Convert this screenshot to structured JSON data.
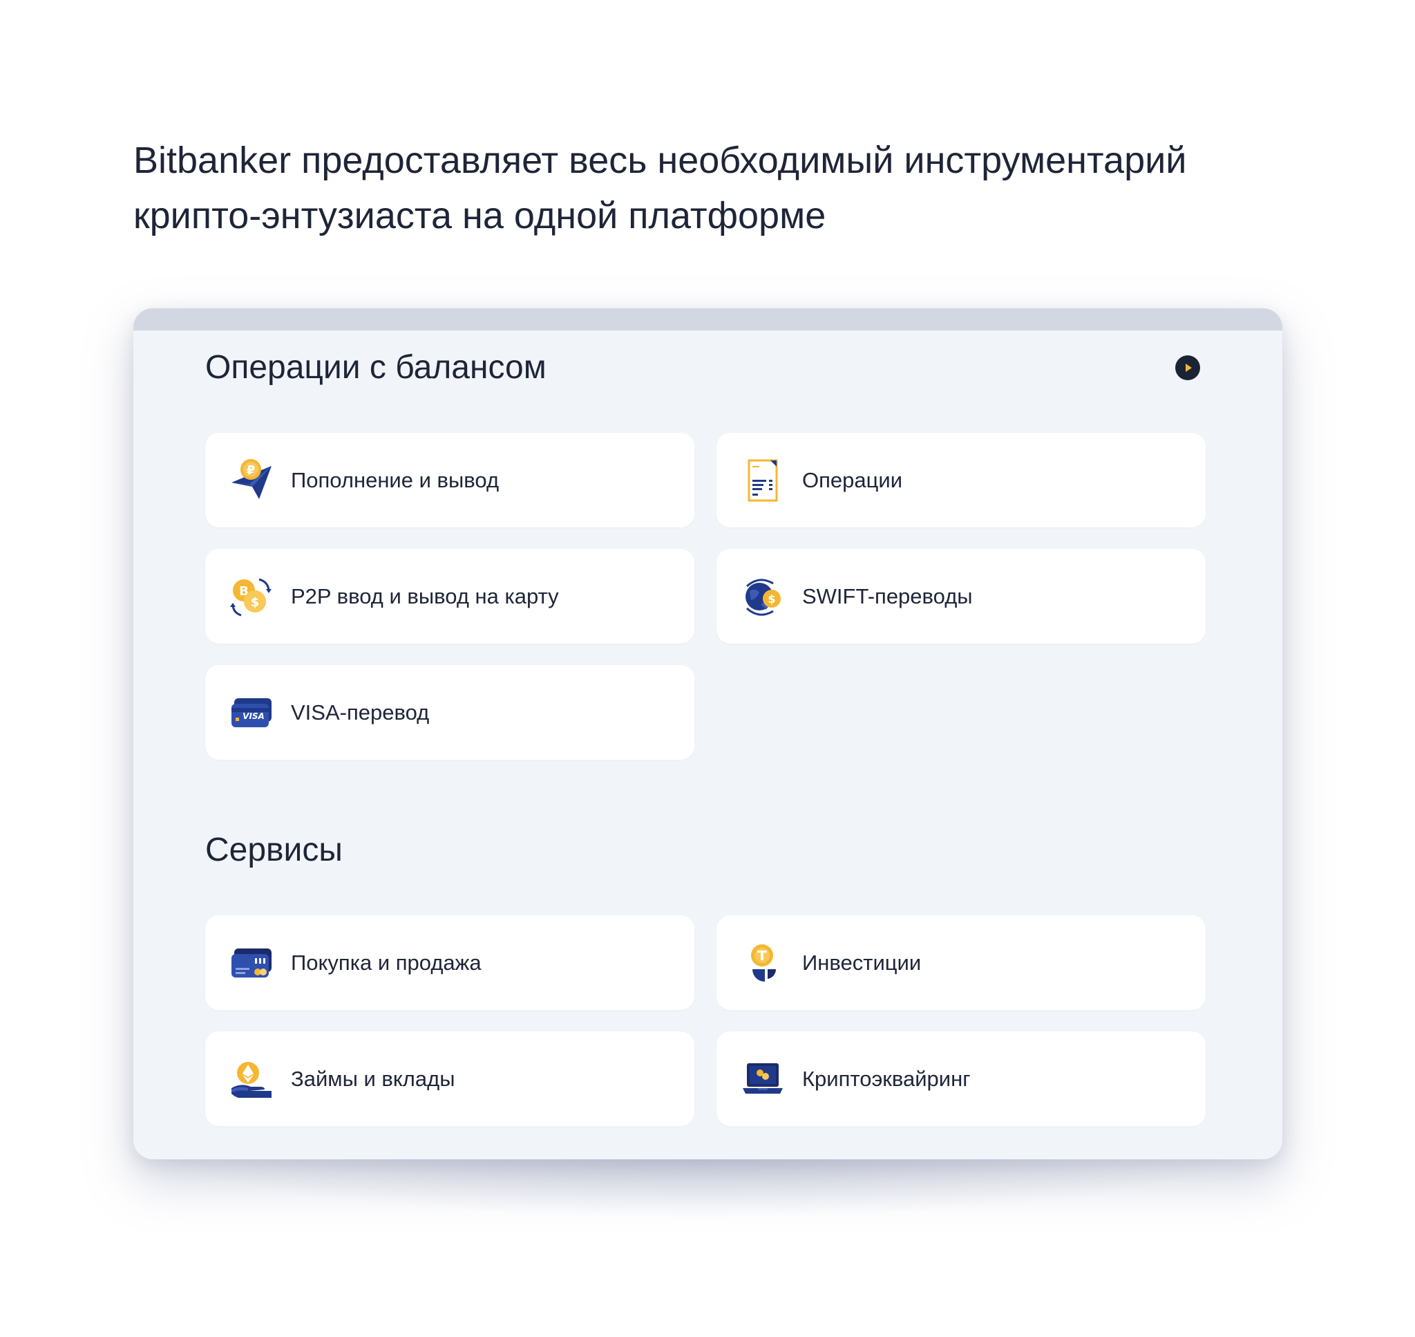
{
  "headline": {
    "line1": "Bitbanker предоставляет весь необходимый инструментарий",
    "line2": "крипто-энтузиаста на одной платформе"
  },
  "balance_ops": {
    "title": "Операции с балансом",
    "play_icon": "play-icon",
    "items": [
      {
        "label": "Пополнение и вывод",
        "icon": "paper-plane-ruble-icon"
      },
      {
        "label": "Операции",
        "icon": "document-list-icon"
      },
      {
        "label": "P2P ввод и вывод на карту",
        "icon": "coin-exchange-icon"
      },
      {
        "label": "SWIFT-переводы",
        "icon": "globe-dollar-icon"
      },
      {
        "label": "VISA-перевод",
        "icon": "visa-card-icon"
      }
    ]
  },
  "services": {
    "title": "Сервисы",
    "items": [
      {
        "label": "Покупка и продажа",
        "icon": "wallet-card-icon"
      },
      {
        "label": "Инвестиции",
        "icon": "tether-pie-icon"
      },
      {
        "label": "Займы и вклады",
        "icon": "hand-ethereum-icon"
      },
      {
        "label": "Криптоэквайринг",
        "icon": "laptop-coins-icon"
      }
    ]
  },
  "colors": {
    "accent_yellow": "#f5b731",
    "brand_navy": "#1f3a8a",
    "dark_navy": "#1b2336",
    "panel_bg": "#f1f4f9",
    "card_bg": "#ffffff",
    "topbar": "#d2d7e1"
  }
}
